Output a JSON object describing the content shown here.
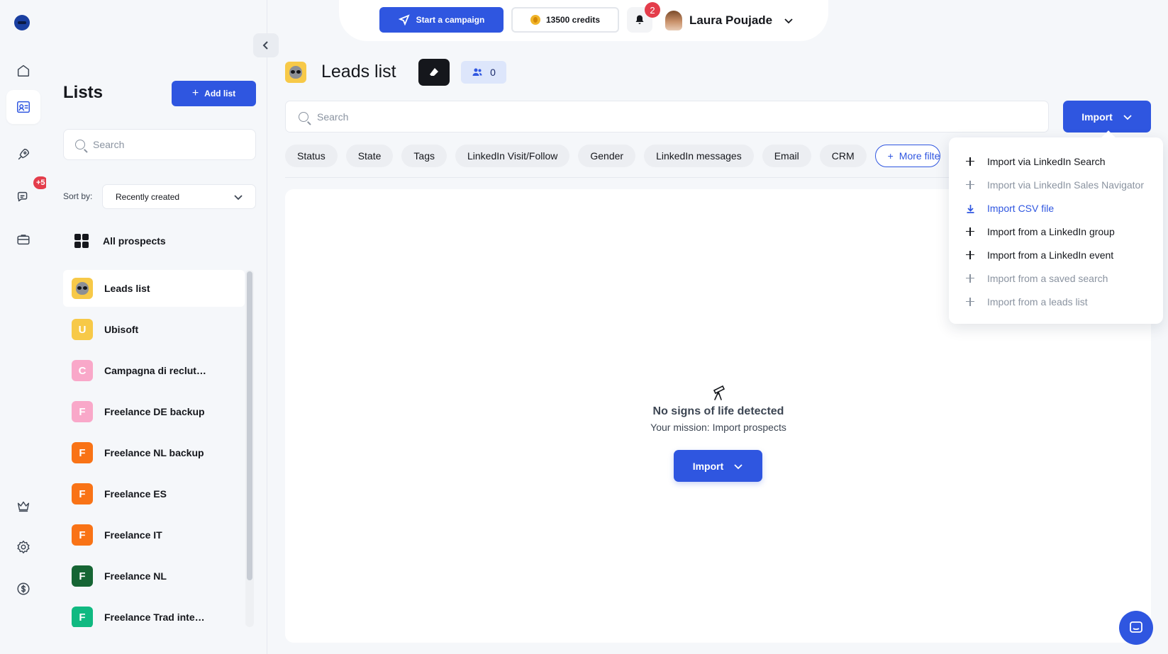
{
  "topbar": {
    "campaign_label": "Start a campaign",
    "credits_label": "13500 credits",
    "notifications_count": "2",
    "user_name": "Laura Poujade"
  },
  "rail": {
    "messages_badge": "+5",
    "icons": [
      "home-icon",
      "contacts-icon",
      "rocket-icon",
      "messages-icon",
      "briefcase-icon",
      "crown-icon",
      "settings-icon",
      "billing-icon"
    ]
  },
  "lists_panel": {
    "title": "Lists",
    "add_label": "Add list",
    "search_placeholder": "Search",
    "sort_label": "Sort by:",
    "sort_value": "Recently created",
    "all_prospects": "All prospects",
    "items": [
      {
        "label": "Leads list",
        "initial": "",
        "color": "#f7c948"
      },
      {
        "label": "Ubisoft",
        "initial": "U",
        "color": "#f7c948"
      },
      {
        "label": "Campagna di reclut…",
        "initial": "C",
        "color": "#f9a8c9"
      },
      {
        "label": "Freelance DE backup",
        "initial": "F",
        "color": "#f9a8c9"
      },
      {
        "label": "Freelance NL backup",
        "initial": "F",
        "color": "#f97316"
      },
      {
        "label": "Freelance ES",
        "initial": "F",
        "color": "#f97316"
      },
      {
        "label": "Freelance IT",
        "initial": "F",
        "color": "#f97316"
      },
      {
        "label": "Freelance NL",
        "initial": "F",
        "color": "#166534"
      },
      {
        "label": "Freelance Trad inte…",
        "initial": "F",
        "color": "#10b981"
      }
    ]
  },
  "main": {
    "title": "Leads list",
    "prospect_count": "0",
    "search_placeholder": "Search",
    "import_label": "Import",
    "filters": [
      "Status",
      "State",
      "Tags",
      "LinkedIn Visit/Follow",
      "Gender",
      "LinkedIn messages",
      "Email",
      "CRM"
    ],
    "more_filters_label": "More filters",
    "empty_title": "No signs of life detected",
    "empty_subtitle": "Your mission: Import prospects"
  },
  "import_menu": {
    "items": [
      {
        "label": "Import via LinkedIn Search",
        "state": "enabled",
        "icon": "plus-icon"
      },
      {
        "label": "Import via LinkedIn Sales Navigator",
        "state": "disabled",
        "icon": "plus-icon"
      },
      {
        "label": "Import CSV file",
        "state": "accent",
        "icon": "download-icon"
      },
      {
        "label": "Import from a LinkedIn group",
        "state": "enabled",
        "icon": "plus-icon"
      },
      {
        "label": "Import from a LinkedIn event",
        "state": "enabled",
        "icon": "plus-icon"
      },
      {
        "label": "Import from a saved search",
        "state": "disabled",
        "icon": "plus-icon"
      },
      {
        "label": "Import from a leads list",
        "state": "disabled",
        "icon": "plus-icon"
      }
    ]
  },
  "colors": {
    "accent": "#2f56e0",
    "badge": "#e43d4b",
    "background": "#f5f7fa"
  }
}
